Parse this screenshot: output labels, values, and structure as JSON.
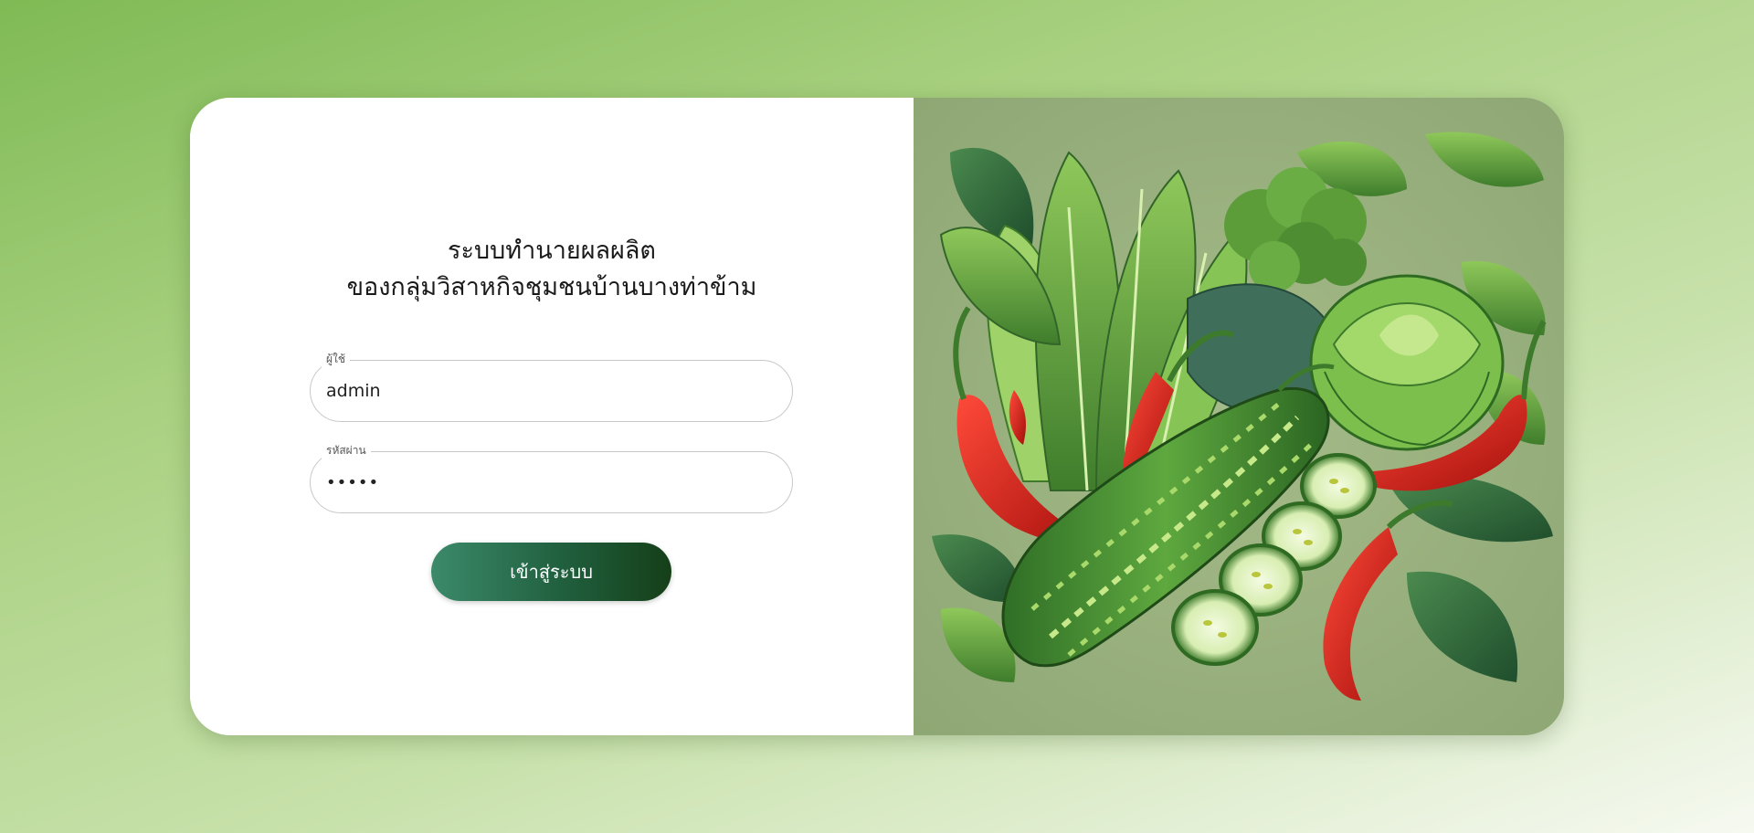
{
  "login": {
    "title_line1": "ระบบทำนายผลผลิต",
    "title_line2": "ของกลุ่มวิสาหกิจชุมชนบ้านบางท่าข้าม",
    "username_label": "ผู้ใช้",
    "username_value": "admin",
    "password_label": "รหัสผ่าน",
    "password_value": "•••••",
    "submit_label": "เข้าสู่ระบบ"
  },
  "colors": {
    "page_gradient_start": "#7fba55",
    "page_gradient_end": "#f6f9f1",
    "button_gradient_start": "#3b8a6a",
    "button_gradient_end": "#153f18",
    "illustration_background": "#97ae7a"
  },
  "illustration": {
    "subject": "vegetables-illustration",
    "items": [
      "leafy-greens",
      "broccoli",
      "cabbage",
      "red-chili-peppers",
      "bitter-melon",
      "cucumber-slices",
      "basil-leaves"
    ]
  }
}
